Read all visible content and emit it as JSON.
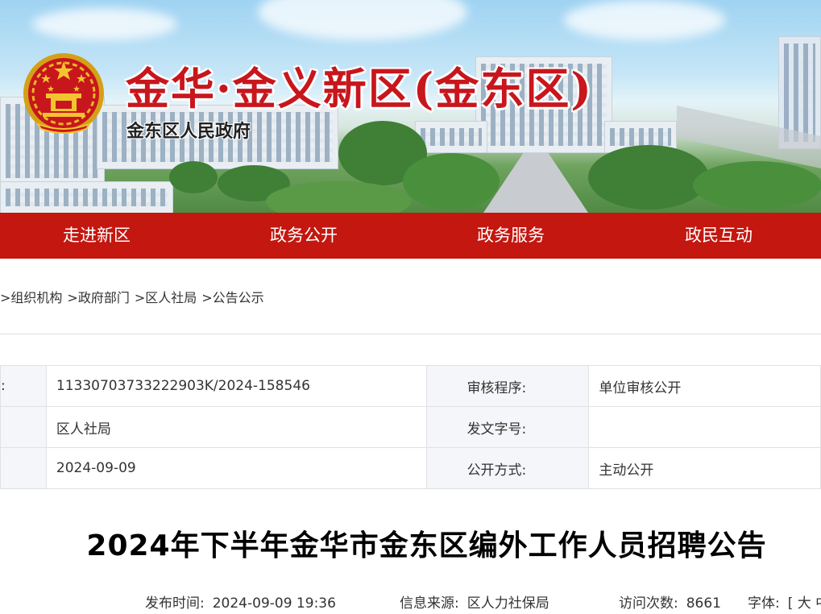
{
  "banner": {
    "title": "金华·金义新区(金东区)",
    "subtitle": "金东区人民政府",
    "emblem_icon": "national-emblem-icon",
    "accent_color": "#c8161d"
  },
  "nav": {
    "color": "#c3170f",
    "items": [
      {
        "label": "走进新区"
      },
      {
        "label": "政务公开"
      },
      {
        "label": "政务服务"
      },
      {
        "label": "政民互动"
      }
    ]
  },
  "breadcrumb": {
    "separator": ">",
    "items": [
      "组织机构",
      "政府部门",
      "区人社局",
      "公告公示"
    ]
  },
  "info": {
    "row1": {
      "left_label": ":",
      "left_value": "11330703733222903K/2024-158546",
      "right_label": "审核程序:",
      "right_value": "单位审核公开"
    },
    "row2": {
      "left_value": "区人社局",
      "right_label": "发文字号:",
      "right_value": ""
    },
    "row3": {
      "left_value": "2024-09-09",
      "right_label": "公开方式:",
      "right_value": "主动公开"
    }
  },
  "article": {
    "title": "2024年下半年金华市金东区编外工作人员招聘公告",
    "publish_label": "发布时间:",
    "publish_value": "2024-09-09 19:36",
    "source_label": "信息来源:",
    "source_value": "区人力社保局",
    "visits_label": "访问次数:",
    "visits_value": "8661",
    "font_label": "字体:",
    "font_value": "[ 大 中"
  }
}
